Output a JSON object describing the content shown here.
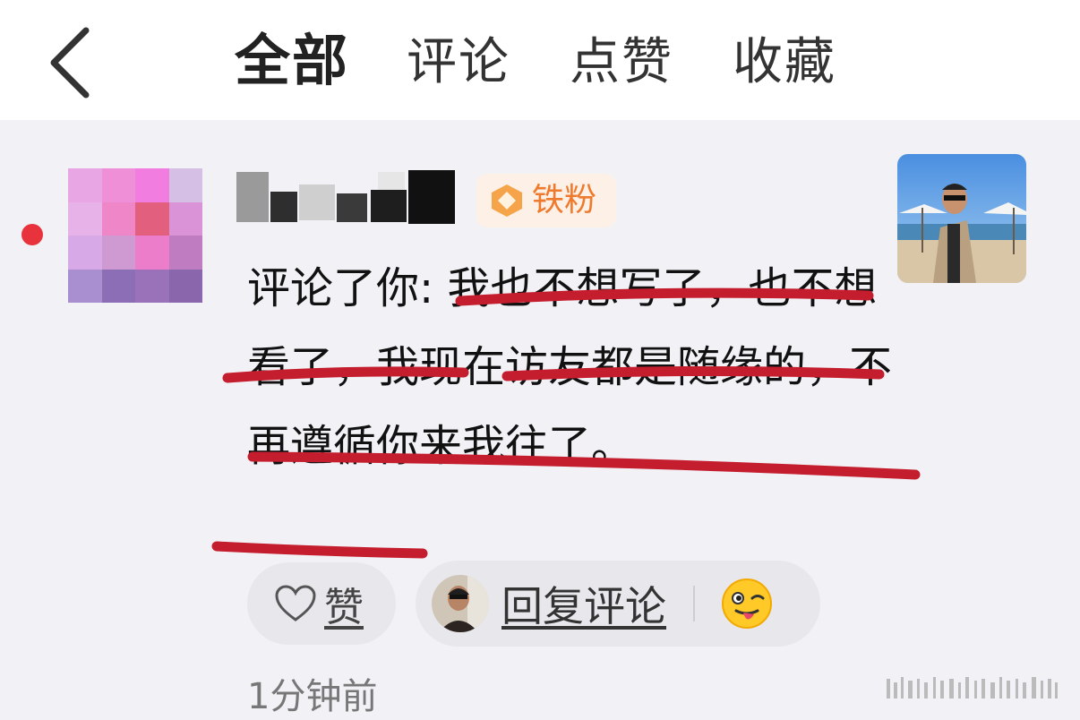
{
  "header": {
    "tabs": [
      {
        "label": "全部",
        "active": true
      },
      {
        "label": "评论",
        "active": false
      },
      {
        "label": "点赞",
        "active": false
      },
      {
        "label": "收藏",
        "active": false
      }
    ]
  },
  "notification": {
    "badge_label": "铁粉",
    "comment_prefix": "评论了你: ",
    "comment_text": "我也不想写了，也不想看了，我现在访友都是随缘的，不再遵循你来我往了。",
    "like_label": "赞",
    "reply_label": "回复评论",
    "timestamp": "1分钟前"
  },
  "colors": {
    "accent_red": "#e8323c",
    "badge_orange": "#ee7a2e",
    "underline_red": "#c41e2e"
  }
}
